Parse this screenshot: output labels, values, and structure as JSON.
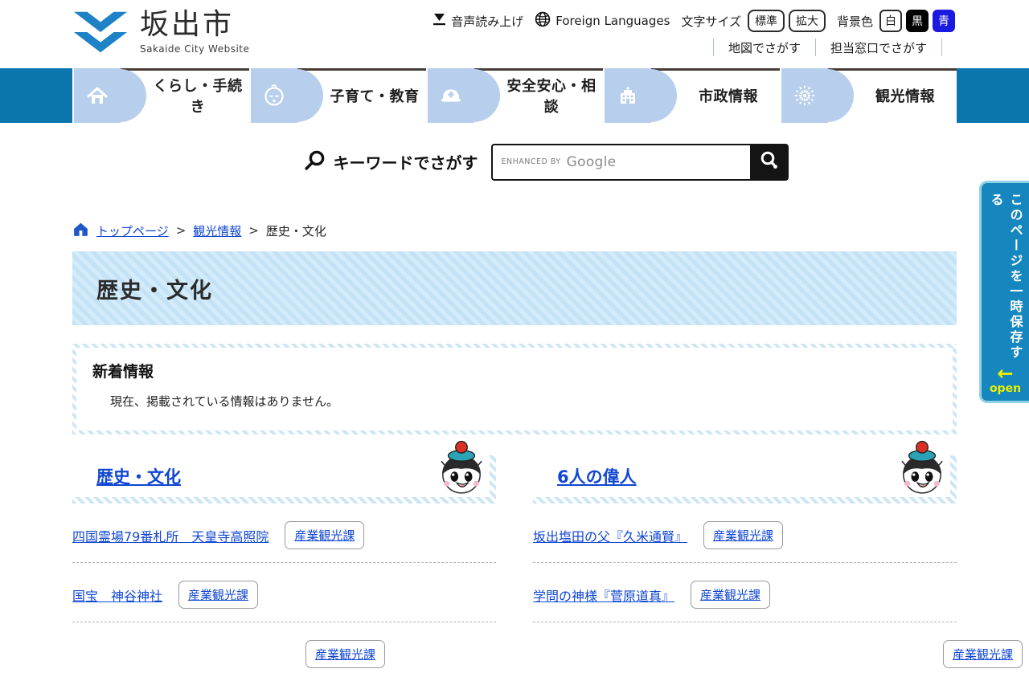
{
  "header": {
    "logo_title": "坂出市",
    "logo_subtitle": "Sakaide City Website",
    "audio_label": "音声読み上げ",
    "foreign_label": "Foreign Languages",
    "text_size_label": "文字サイズ",
    "text_size_standard": "標準",
    "text_size_large": "拡大",
    "bg_label": "背景色",
    "bg_white": "白",
    "bg_black": "黒",
    "bg_blue": "青",
    "link_map": "地図でさがす",
    "link_desk": "担当窓口でさがす"
  },
  "nav": {
    "items": [
      {
        "label": "くらし・手続き",
        "icon": "home-icon"
      },
      {
        "label": "子育て・教育",
        "icon": "baby-icon"
      },
      {
        "label": "安全安心・相談",
        "icon": "helmet-icon"
      },
      {
        "label": "市政情報",
        "icon": "cityhall-icon"
      },
      {
        "label": "観光情報",
        "icon": "firework-icon"
      }
    ]
  },
  "search": {
    "label": "キーワードでさがす",
    "enhanced_by": "ENHANCED BY",
    "google": "Google"
  },
  "breadcrumb": {
    "home": "トップページ",
    "sep": ">",
    "level1": "観光情報",
    "current": "歴史・文化"
  },
  "page_title": "歴史・文化",
  "news": {
    "title": "新着情報",
    "empty": "現在、掲載されている情報はありません。"
  },
  "columns": [
    {
      "title": "歴史・文化",
      "items": [
        {
          "label": "四国霊場79番札所　天皇寺高照院",
          "badge": "産業観光課"
        },
        {
          "label": "国宝　神谷神社",
          "badge": "産業観光課"
        },
        {
          "label": "",
          "badge": "産業観光課"
        }
      ]
    },
    {
      "title": "6人の偉人",
      "items": [
        {
          "label": "坂出塩田の父『久米通賢』",
          "badge": "産業観光課"
        },
        {
          "label": "学問の神様『菅原道真』",
          "badge": "産業観光課"
        },
        {
          "label": "",
          "badge": "産業観光課"
        }
      ]
    }
  ],
  "side_tab": {
    "label": "このページを一時保存する",
    "arrow": "←",
    "open": "open"
  },
  "colors": {
    "nav_blue": "#0b76ae",
    "nav_icon_bg": "#b7cfec",
    "banner_blue": "#c3e2f5",
    "link_blue": "#0f46d2",
    "side_tab_blue": "#1687be",
    "accent_yellow": "#eef000",
    "btn_black": "#000000",
    "btn_blue": "#1a1ae0"
  }
}
